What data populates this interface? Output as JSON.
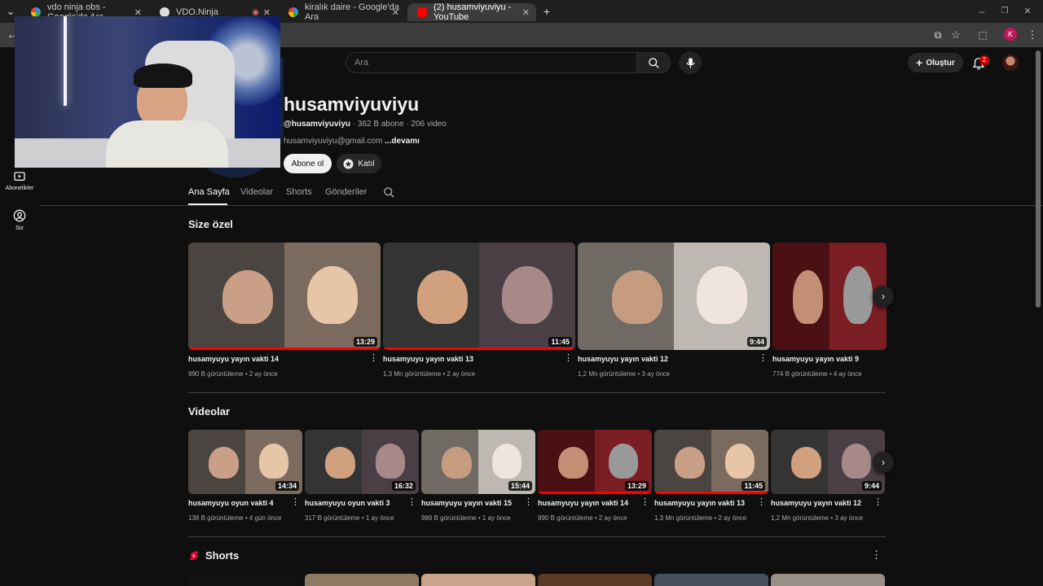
{
  "browser": {
    "tabs": [
      {
        "title": "vdo ninja obs - Google'da Ara",
        "favicon": "google-icon",
        "active": false
      },
      {
        "title": "VDO.Ninja",
        "favicon": "vdo-ninja-icon",
        "active": false
      },
      {
        "title": "kiralık daire - Google'da Ara",
        "favicon": "google-icon",
        "active": false
      },
      {
        "title": "(2) husamviyuviyu - YouTube",
        "favicon": "youtube-icon",
        "active": true
      }
    ],
    "profile_initial": "K"
  },
  "header": {
    "search_placeholder": "Ara",
    "create_label": "Oluştur",
    "notification_count": "2"
  },
  "guide": {
    "items": [
      {
        "label": "Abonelikler",
        "icon": "subscriptions-icon"
      },
      {
        "label": "Siz",
        "icon": "you-icon"
      }
    ]
  },
  "channel": {
    "name": "husamviyuviyu",
    "handle": "@husamviyuviyu",
    "subscribers": "362 B abone",
    "videos": "206 video",
    "email": "husamviyuviyu@gmail.com",
    "more_label": "...devamı",
    "subscribe_label": "Abone ol",
    "join_label": "Katıl"
  },
  "tabs": [
    "Ana Sayfa",
    "Videolar",
    "Shorts",
    "Gönderiler"
  ],
  "sections": {
    "for_you": {
      "title": "Size özel",
      "videos": [
        {
          "title": "husamyuyu yayın vakti 14",
          "views": "990 B görüntüleme",
          "age": "2 ay önce",
          "duration": "13:29",
          "watched": 1.0
        },
        {
          "title": "husamyuyu yayın vakti 13",
          "views": "1,3 Mn görüntüleme",
          "age": "2 ay önce",
          "duration": "11:45",
          "watched": 1.0
        },
        {
          "title": "husamyuyu yayın vakti 12",
          "views": "1,2 Mn görüntüleme",
          "age": "3 ay önce",
          "duration": "9:44",
          "watched": 0.0
        },
        {
          "title": "husamyuyu yayın vakti 9",
          "views": "774 B görüntüleme",
          "age": "4 ay önce",
          "duration": "",
          "watched": 0.0
        }
      ]
    },
    "videos": {
      "title": "Videolar",
      "videos": [
        {
          "title": "husamyuyu oyun vakti 4",
          "views": "138 B görüntüleme",
          "age": "4 gün önce",
          "duration": "14:34",
          "watched": 0.0
        },
        {
          "title": "husamyuyu oyun vakti 3",
          "views": "317 B görüntüleme",
          "age": "1 ay önce",
          "duration": "16:32",
          "watched": 0.0
        },
        {
          "title": "husamyuyu yayın vakti 15",
          "views": "989 B görüntüleme",
          "age": "1 ay önce",
          "duration": "15:44",
          "watched": 0.0
        },
        {
          "title": "husamyuyu yayın vakti 14",
          "views": "990 B görüntüleme",
          "age": "2 ay önce",
          "duration": "13:29",
          "watched": 1.0
        },
        {
          "title": "husamyuyu yayın vakti 13",
          "views": "1,3 Mn görüntüleme",
          "age": "2 ay önce",
          "duration": "11:45",
          "watched": 1.0
        },
        {
          "title": "husamyuyu yayın vakti 12",
          "views": "1,2 Mn görüntüleme",
          "age": "3 ay önce",
          "duration": "9:44",
          "watched": 0.0
        }
      ]
    },
    "shorts": {
      "title": "Shorts"
    }
  },
  "colors": {
    "background": "#0f0f0f",
    "progress_red": "#ff0000",
    "accent_red": "#cc0000"
  }
}
